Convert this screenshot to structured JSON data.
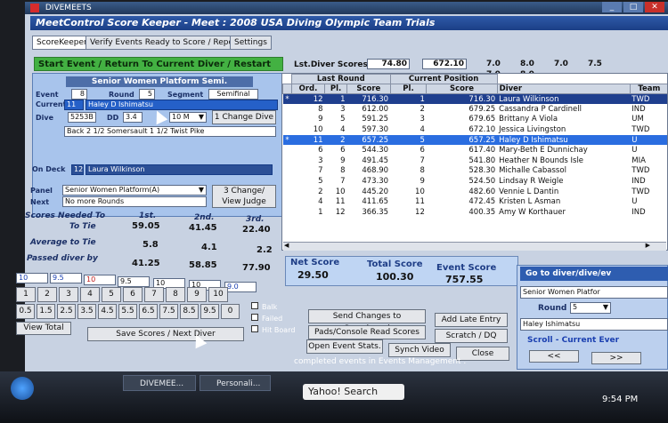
{
  "window": {
    "title": "DIVEMEETS",
    "minimize": "_",
    "maximize": "□",
    "close": "✕"
  },
  "app": {
    "subtitle": "MeetControl Score Keeper - Meet : 2008 USA Diving Olympic Team Trials"
  },
  "tabs": [
    "ScoreKeeper",
    "Verify Events Ready to Score / Reports",
    "Settings"
  ],
  "start_event_label": "Start Event / Return To Current Diver / Restart Event",
  "event_panel": {
    "header": "Senior Women Platform Semi.",
    "event_label": "Event",
    "event_value": "8",
    "round_label": "Round",
    "round_value": "5",
    "segment_label": "Segment",
    "segment_value": "Semifinal",
    "current_label": "Current",
    "current_num": "11",
    "current_name": "Haley D Ishimatsu",
    "dive_label": "Dive",
    "dive_code": "5253B",
    "dd_label": "DD",
    "dd_value": "3.4",
    "height_value": "10 M",
    "change_dive_label": "1 Change Dive",
    "dive_description": "Back 2 1/2 Somersault 1 1/2 Twist Pike",
    "on_deck_label": "On Deck",
    "on_deck_num": "12",
    "on_deck_name": "Laura Wilkinson",
    "panel_label": "Panel",
    "panel_value": "Senior Women Platform(A)",
    "next_label": "Next",
    "next_value": "No more Rounds",
    "change_judge_label": "3 Change/ View Judge"
  },
  "scores_needed": {
    "title": "Scores Needed To",
    "col1": "1st.",
    "col2": "2nd.",
    "col3": "3rd.",
    "rows": [
      {
        "label": "To Tie",
        "v1": "59.05",
        "v2": "41.45",
        "v3": "22.40"
      },
      {
        "label": "Average to Tie",
        "v1": "5.8",
        "v2": "4.1",
        "v3": "2.2"
      },
      {
        "label": "Passed diver by",
        "v1": "41.25",
        "v2": "58.85",
        "v3": "77.90"
      }
    ]
  },
  "last_diver": {
    "label": "Lst.Diver Scores :",
    "score1": "74.80",
    "score2": "672.10",
    "awards_row1": [
      "7.0",
      "8.0",
      "7.0",
      "7.5"
    ],
    "awards_row2": [
      "7.0",
      "8.0"
    ]
  },
  "results_table": {
    "group_last_round": "Last Round",
    "group_current": "Current Position",
    "headers": [
      "Ord.",
      "Pl.",
      "Score",
      "Pl.",
      "Score",
      "Diver",
      "Team"
    ],
    "rows": [
      {
        "mark": "*",
        "ord": "12",
        "pl": "1",
        "score": "716.30",
        "cpl": "1",
        "cscore": "716.30",
        "diver": "Laura Wilkinson",
        "team": "TWD"
      },
      {
        "mark": "",
        "ord": "8",
        "pl": "3",
        "score": "612.00",
        "cpl": "2",
        "cscore": "679.25",
        "diver": "Cassandra P Cardinell",
        "team": "IND"
      },
      {
        "mark": "",
        "ord": "9",
        "pl": "5",
        "score": "591.25",
        "cpl": "3",
        "cscore": "679.65",
        "diver": "Brittany A Viola",
        "team": "UM"
      },
      {
        "mark": "",
        "ord": "10",
        "pl": "4",
        "score": "597.30",
        "cpl": "4",
        "cscore": "672.10",
        "diver": "Jessica Livingston",
        "team": "TWD"
      },
      {
        "mark": "*",
        "ord": "11",
        "pl": "2",
        "score": "657.25",
        "cpl": "5",
        "cscore": "657.25",
        "diver": "Haley D Ishimatsu",
        "team": "U"
      },
      {
        "mark": "",
        "ord": "6",
        "pl": "6",
        "score": "544.30",
        "cpl": "6",
        "cscore": "617.40",
        "diver": "Mary-Beth E Dunnichay",
        "team": "U"
      },
      {
        "mark": "",
        "ord": "3",
        "pl": "9",
        "score": "491.45",
        "cpl": "7",
        "cscore": "541.80",
        "diver": "Heather N Bounds Isle",
        "team": "MIA"
      },
      {
        "mark": "",
        "ord": "7",
        "pl": "8",
        "score": "468.90",
        "cpl": "8",
        "cscore": "528.30",
        "diver": "Michalle Cabassol",
        "team": "TWD"
      },
      {
        "mark": "",
        "ord": "5",
        "pl": "7",
        "score": "473.30",
        "cpl": "9",
        "cscore": "524.50",
        "diver": "Lindsay R Weigle",
        "team": "IND"
      },
      {
        "mark": "",
        "ord": "2",
        "pl": "10",
        "score": "445.20",
        "cpl": "10",
        "cscore": "482.60",
        "diver": "Vennie L Dantin",
        "team": "TWD"
      },
      {
        "mark": "",
        "ord": "4",
        "pl": "11",
        "score": "411.65",
        "cpl": "11",
        "cscore": "472.45",
        "diver": "Kristen L Asman",
        "team": "U"
      },
      {
        "mark": "",
        "ord": "1",
        "pl": "12",
        "score": "366.35",
        "cpl": "12",
        "cscore": "400.35",
        "diver": "Amy W Korthauer",
        "team": "IND"
      }
    ]
  },
  "totals": {
    "net_label": "Net Score",
    "net_value": "29.50",
    "total_label": "Total Score",
    "total_value": "100.30",
    "event_label": "Event Score",
    "event_value": "757.55"
  },
  "judge_inputs": [
    "10",
    "9.5",
    "10",
    "9.5",
    "10",
    "10",
    "9.0"
  ],
  "keypad": {
    "row1": [
      "1",
      "2",
      "3",
      "4",
      "5",
      "6",
      "7",
      "8",
      "9",
      "10"
    ],
    "row2": [
      "0.5",
      "1.5",
      "2.5",
      "3.5",
      "4.5",
      "5.5",
      "6.5",
      "7.5",
      "8.5",
      "9.5",
      "0"
    ]
  },
  "checkboxes": [
    "Balk",
    "Failed",
    "Hit Board"
  ],
  "actions": {
    "view_total": "View Total",
    "save_scores": "Save Scores / Next Diver",
    "send_changes": "Send Changes to Scoreboard",
    "pads_console": "Pads/Console Read Scores",
    "open_event_stats": "Open Event Stats.",
    "synch_video": "Synch Video",
    "add_late_entry": "Add Late Entry",
    "scratch_dq": "Scratch / DQ",
    "close": "Close"
  },
  "goto_panel": {
    "title": "Go to diver/dive/ev",
    "event_value": "Senior Women Platfor",
    "round_label": "Round",
    "round_value": "5",
    "diver_value": "Haley Ishimatsu",
    "scroll_label": "Scroll - Current Ever",
    "prev": "<<",
    "next": ">>"
  },
  "status_text": "completed events in Events Management .",
  "taskbar": {
    "items": [
      "DIVEMEE...",
      "Personali..."
    ],
    "search_label": "Yahoo! Search",
    "clock": "9:54 PM"
  }
}
